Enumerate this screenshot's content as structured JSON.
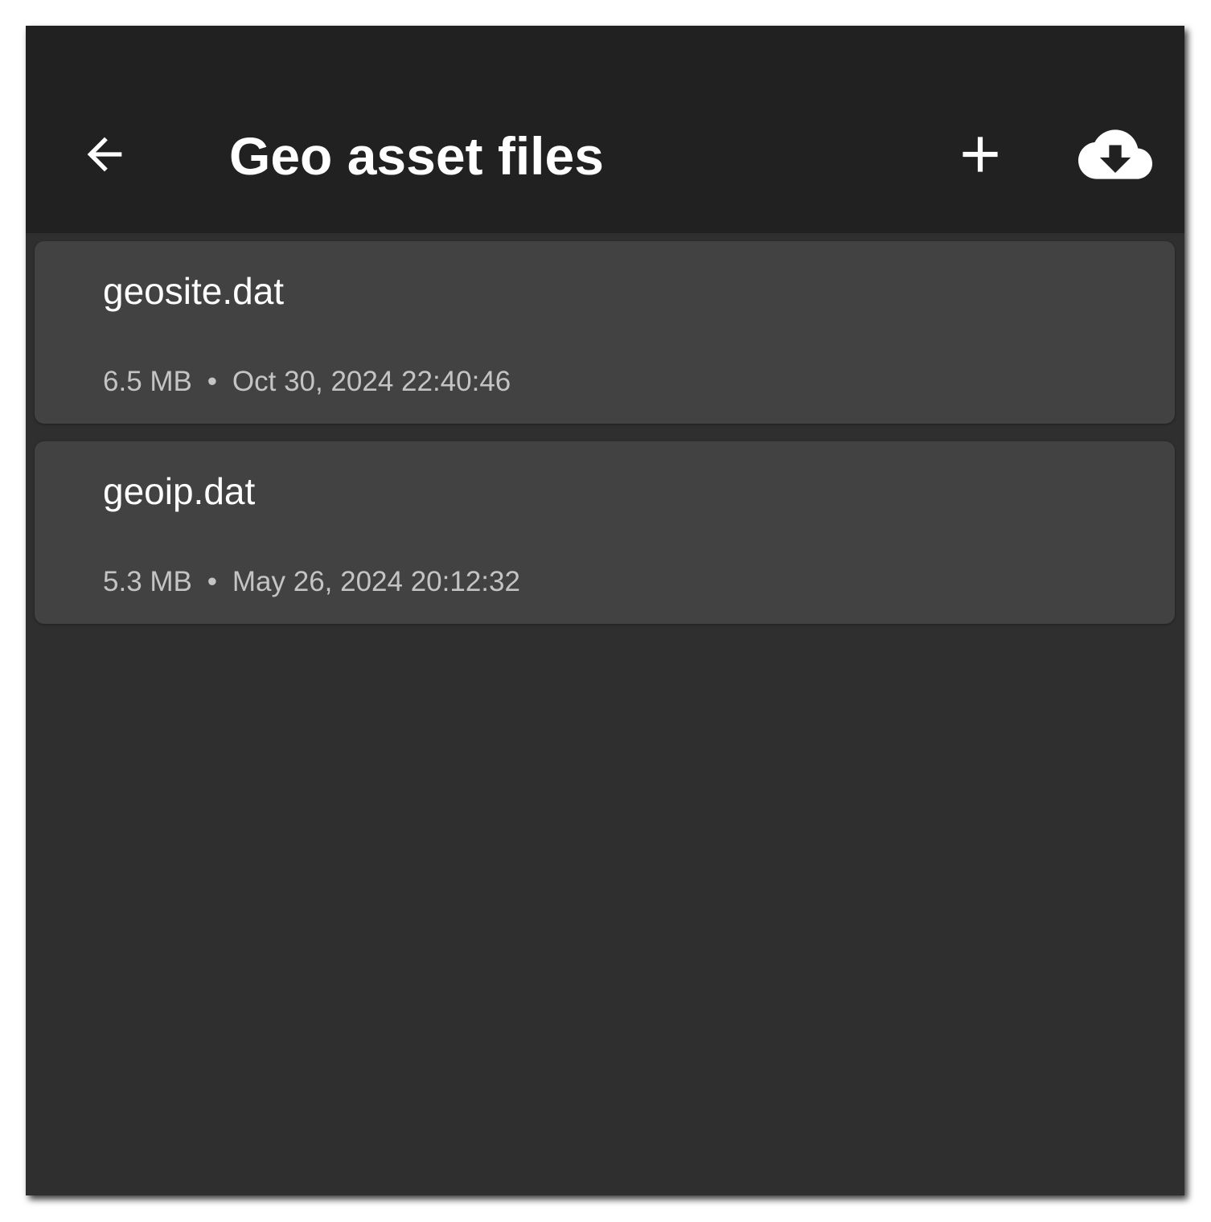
{
  "app_bar": {
    "title": "Geo asset files",
    "back_icon": "arrow-left-icon",
    "add_icon": "plus-icon",
    "download_icon": "cloud-download-icon"
  },
  "files": [
    {
      "name": "geosite.dat",
      "size": "6.5 MB",
      "separator": "•",
      "modified": "Oct 30, 2024 22:40:46"
    },
    {
      "name": "geoip.dat",
      "size": "5.3 MB",
      "separator": "•",
      "modified": "May 26, 2024 20:12:32"
    }
  ],
  "colors": {
    "app_bar_bg": "#212121",
    "content_bg": "#2f2f2f",
    "card_bg": "#424242",
    "primary_text": "#ffffff",
    "secondary_text": "#c4c4c4"
  }
}
